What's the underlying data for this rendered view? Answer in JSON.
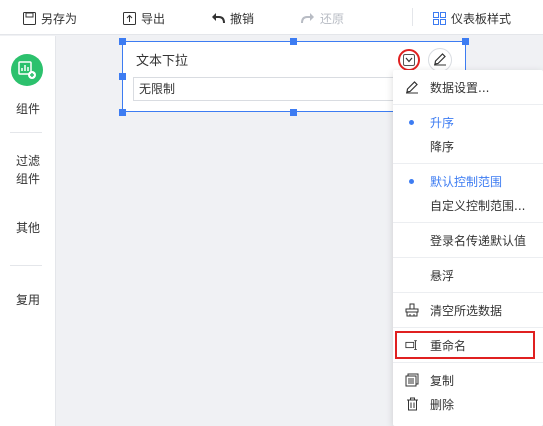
{
  "toolbar": {
    "save_as": "另存为",
    "export": "导出",
    "undo": "撤销",
    "redo": "还原",
    "dashboard_style": "仪表板样式"
  },
  "sidebar": {
    "items": [
      {
        "label": "组件"
      },
      {
        "label": "过滤\n组件"
      },
      {
        "label": "其他"
      },
      {
        "label": "复用"
      }
    ]
  },
  "widget": {
    "title": "文本下拉",
    "input_value": "无限制"
  },
  "menu": {
    "items": [
      {
        "label": "数据设置...",
        "icon": "pencil-icon"
      },
      {
        "label": "升序",
        "active": true
      },
      {
        "label": "降序"
      },
      {
        "label": "默认控制范围",
        "active": true
      },
      {
        "label": "自定义控制范围..."
      },
      {
        "label": "登录名传递默认值"
      },
      {
        "label": "悬浮"
      },
      {
        "label": "清空所选数据",
        "icon": "clear-brush-icon"
      },
      {
        "label": "重命名",
        "icon": "rename-icon",
        "highlighted": true
      },
      {
        "label": "复制",
        "icon": "copy-icon"
      },
      {
        "label": "删除",
        "icon": "trash-icon"
      }
    ]
  },
  "colors": {
    "accent": "#3d7cf2",
    "highlight_red": "#e02020",
    "component_green": "#2cc16d"
  }
}
